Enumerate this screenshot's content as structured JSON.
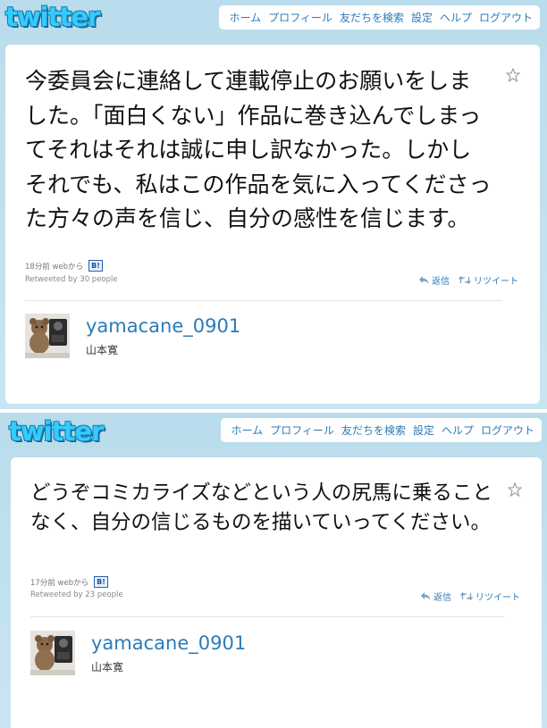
{
  "nav": {
    "home": "ホーム",
    "profile": "プロフィール",
    "find_friends": "友だちを検索",
    "settings": "設定",
    "help": "ヘルプ",
    "logout": "ログアウト"
  },
  "logo": "twitter",
  "tweets": [
    {
      "text": "今委員会に連絡して連載停止のお願いをしました。「面白くない」作品に巻き込んでしまってそれはそれは誠に申し訳なかった。しかしそれでも、私はこの作品を気に入ってくださった方々の声を信じ、自分の感性を信じます。",
      "time": "18分前",
      "via": "webから",
      "badge": "B!",
      "retweeted_by": "Retweeted by 30 people",
      "reply": "返信",
      "retweet": "リツイート",
      "screen_name": "yamacane_0901",
      "full_name": "山本寛"
    },
    {
      "text": "どうぞコミカライズなどという人の尻馬に乗ることなく、自分の信じるものを描いていってください。",
      "time": "17分前",
      "via": "webから",
      "badge": "B!",
      "retweeted_by": "Retweeted by 23 people",
      "reply": "返信",
      "retweet": "リツイート",
      "screen_name": "yamacane_0901",
      "full_name": "山本寛"
    }
  ],
  "colors": {
    "background": "#c0deed",
    "link": "#2b7bb9",
    "logo": "#33ccff"
  },
  "icons": [
    "star-icon",
    "reply-icon",
    "retweet-icon",
    "avatar-photo"
  ]
}
